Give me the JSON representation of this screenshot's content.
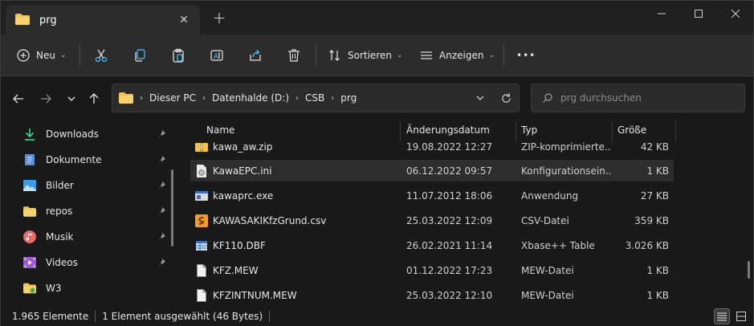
{
  "tab": {
    "title": "prg"
  },
  "commandbar": {
    "new_label": "Neu",
    "sort_label": "Sortieren",
    "view_label": "Anzeigen",
    "more_label": "•••"
  },
  "address": {
    "crumbs": [
      "Dieser PC",
      "Datenhalde (D:)",
      "CSB",
      "prg"
    ]
  },
  "search": {
    "placeholder": "prg durchsuchen"
  },
  "sidebar": {
    "items": [
      {
        "label": "Downloads",
        "icon": "download-icon",
        "pinned": true
      },
      {
        "label": "Dokumente",
        "icon": "document-icon",
        "pinned": true
      },
      {
        "label": "Bilder",
        "icon": "pictures-icon",
        "pinned": true
      },
      {
        "label": "repos",
        "icon": "folder-icon",
        "pinned": true
      },
      {
        "label": "Musik",
        "icon": "music-icon",
        "pinned": true
      },
      {
        "label": "Videos",
        "icon": "videos-icon",
        "pinned": true
      },
      {
        "label": "W3",
        "icon": "folder-icon",
        "pinned": false
      }
    ]
  },
  "columns": {
    "name": "Name",
    "date": "Änderungsdatum",
    "type": "Typ",
    "size": "Größe"
  },
  "files": [
    {
      "name": "kawa_aw.zip",
      "date": "19.08.2022 12:27",
      "type": "ZIP-komprimierte...",
      "size": "42 KB",
      "icon": "zip-icon",
      "selected": false
    },
    {
      "name": "KawaEPC.ini",
      "date": "06.12.2022 09:57",
      "type": "Konfigurationsein...",
      "size": "1 KB",
      "icon": "ini-file-icon",
      "selected": true
    },
    {
      "name": "kawaprc.exe",
      "date": "11.07.2012 18:06",
      "type": "Anwendung",
      "size": "27 KB",
      "icon": "exe-icon",
      "selected": false
    },
    {
      "name": "KAWASAKIKfzGrund.csv",
      "date": "25.03.2022 12:09",
      "type": "CSV-Datei",
      "size": "359 KB",
      "icon": "csv-icon",
      "selected": false
    },
    {
      "name": "KF110.DBF",
      "date": "26.02.2021 11:14",
      "type": "Xbase++ Table",
      "size": "3.026 KB",
      "icon": "dbf-icon",
      "selected": false
    },
    {
      "name": "KFZ.MEW",
      "date": "01.12.2022 17:23",
      "type": "MEW-Datei",
      "size": "1 KB",
      "icon": "file-icon",
      "selected": false
    },
    {
      "name": "KFZINTNUM.MEW",
      "date": "25.03.2022 12:10",
      "type": "MEW-Datei",
      "size": "1 KB",
      "icon": "file-icon",
      "selected": false
    }
  ],
  "status": {
    "count": "1.965 Elemente",
    "selection": "1 Element ausgewählt (46 Bytes)"
  },
  "colors": {
    "folder": "#f2c14e",
    "accent": "#4cc2ff",
    "selected_row": "#2d2d2d"
  }
}
